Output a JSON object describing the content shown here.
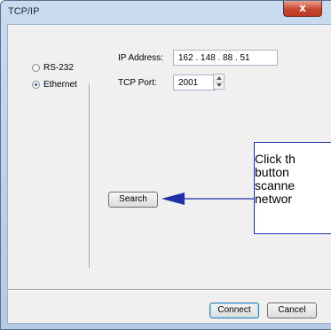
{
  "window": {
    "title": "TCP/IP",
    "close_label": "x"
  },
  "connection": {
    "options": [
      {
        "label": "RS-232",
        "selected": false
      },
      {
        "label": "Ethernet",
        "selected": true
      }
    ]
  },
  "fields": {
    "ip_label": "IP Address:",
    "ip_value": "162  .  148  .  88  .  51",
    "port_label": "TCP Port:",
    "port_value": "2001"
  },
  "buttons": {
    "search": "Search",
    "connect": "Connect",
    "cancel": "Cancel"
  },
  "callout": {
    "text": "Click th\nbutton\nscanne\nnetwor"
  },
  "colors": {
    "arrow": "#1f2fa8"
  }
}
